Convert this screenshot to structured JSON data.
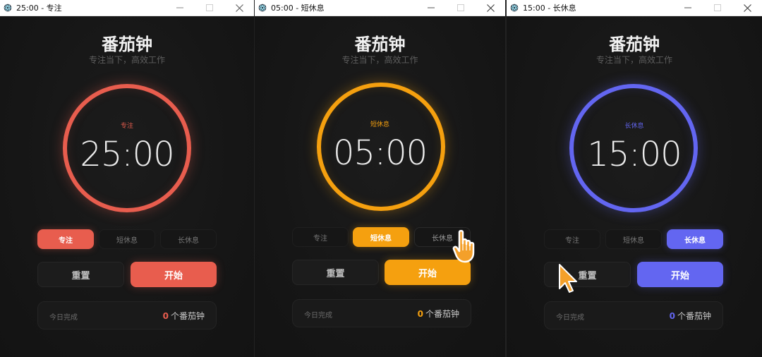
{
  "windows": [
    {
      "title": "25:00 - 专注",
      "app_title": "番茄钟",
      "subtitle": "专注当下，高效工作",
      "mode_label": "专注",
      "time": "25:00",
      "accent": "#e85d4e",
      "tabs": [
        "专注",
        "短休息",
        "长休息"
      ],
      "active_tab": 0,
      "reset_label": "重置",
      "start_label": "开始",
      "stats_label": "今日完成",
      "stats_count": "0",
      "stats_unit": "个番茄钟"
    },
    {
      "title": "05:00 - 短休息",
      "app_title": "番茄钟",
      "subtitle": "专注当下，高效工作",
      "mode_label": "短休息",
      "time": "05:00",
      "accent": "#f5a00f",
      "tabs": [
        "专注",
        "短休息",
        "长休息"
      ],
      "active_tab": 1,
      "reset_label": "重置",
      "start_label": "开始",
      "stats_label": "今日完成",
      "stats_count": "0",
      "stats_unit": "个番茄钟"
    },
    {
      "title": "15:00 - 长休息",
      "app_title": "番茄钟",
      "subtitle": "专注当下，高效工作",
      "mode_label": "长休息",
      "time": "15:00",
      "accent": "#6366f1",
      "tabs": [
        "专注",
        "短休息",
        "长休息"
      ],
      "active_tab": 2,
      "reset_label": "重置",
      "start_label": "开始",
      "stats_label": "今日完成",
      "stats_count": "0",
      "stats_unit": "个番茄钟"
    }
  ],
  "icons": {
    "app": "electron-app-icon",
    "minimize": "minimize-icon",
    "maximize": "maximize-icon",
    "close": "close-icon",
    "hand_cursor": "hand-pointer-icon",
    "arrow_cursor": "arrow-cursor-icon"
  }
}
